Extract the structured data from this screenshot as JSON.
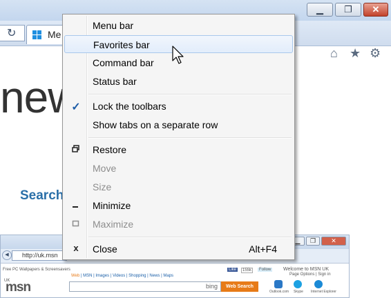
{
  "browser": {
    "tab_label": "Me",
    "window_controls": {
      "minimize": "▁",
      "restore": "❐",
      "close": "✕"
    },
    "toolbar_icons": [
      "home-icon",
      "star-icon",
      "gear-icon"
    ],
    "refresh_icon": "refresh-icon"
  },
  "page": {
    "big_word": "new",
    "search_link": "Search"
  },
  "context_menu": {
    "items": [
      {
        "label": "Menu bar"
      },
      {
        "label": "Favorites bar",
        "hovered": true
      },
      {
        "label": "Command bar"
      },
      {
        "label": "Status bar"
      },
      {
        "label": "Lock the toolbars",
        "checked": true
      },
      {
        "label": "Show tabs on a separate row"
      },
      {
        "label": "Restore",
        "icon": "restore-icon"
      },
      {
        "label": "Move",
        "disabled": true
      },
      {
        "label": "Size",
        "disabled": true
      },
      {
        "label": "Minimize",
        "icon": "minimize-icon"
      },
      {
        "label": "Maximize",
        "icon": "maximize-icon",
        "disabled": true
      },
      {
        "label": "Close",
        "icon": "close-icon",
        "shortcut": "Alt+F4"
      }
    ]
  },
  "background_window": {
    "address": "http://uk.msn",
    "favorites_link": "Free PC Wallpapers & Screensavers",
    "like": "Like",
    "like_count": "155k",
    "follow": "Follow",
    "welcome": "Welcome to MSN UK",
    "page_options": "Page Options | Sign in",
    "region": "UK",
    "logo": "msn",
    "nav": [
      "Web",
      "MSN",
      "Images",
      "Videos",
      "Shopping",
      "News",
      "Maps"
    ],
    "bing": "bing",
    "search_button": "Web Search",
    "services": [
      "Outlook.com",
      "Skype",
      "Internet Explorer"
    ]
  },
  "colors": {
    "hover_border": "#a8c8ec",
    "check": "#1f5ea8",
    "link": "#2a6fa8",
    "search_button": "#e77b18"
  }
}
